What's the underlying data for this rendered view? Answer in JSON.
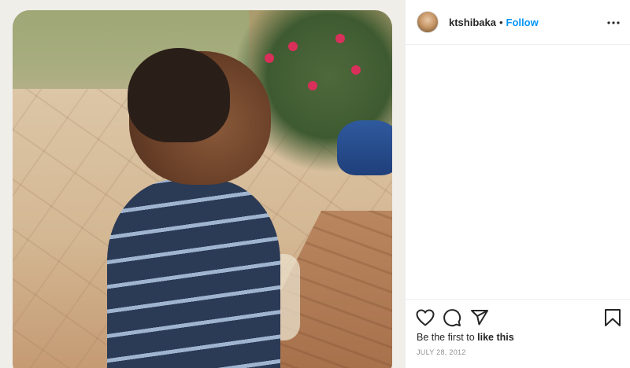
{
  "post": {
    "photo_alt": "",
    "author": {
      "username": "ktshibaka",
      "separator": "•",
      "follow_label": "Follow"
    },
    "more_icon": "more-horizontal-icon",
    "actions": {
      "like_icon": "heart-icon",
      "comment_icon": "comment-icon",
      "share_icon": "share-icon",
      "save_icon": "bookmark-icon"
    },
    "likes": {
      "prefix": "Be the first to ",
      "link": "like this"
    },
    "date": "JULY 28, 2012"
  },
  "colors": {
    "accent": "#0095f6",
    "text": "#262626",
    "muted": "#8e8e8e",
    "border": "#efefef"
  }
}
